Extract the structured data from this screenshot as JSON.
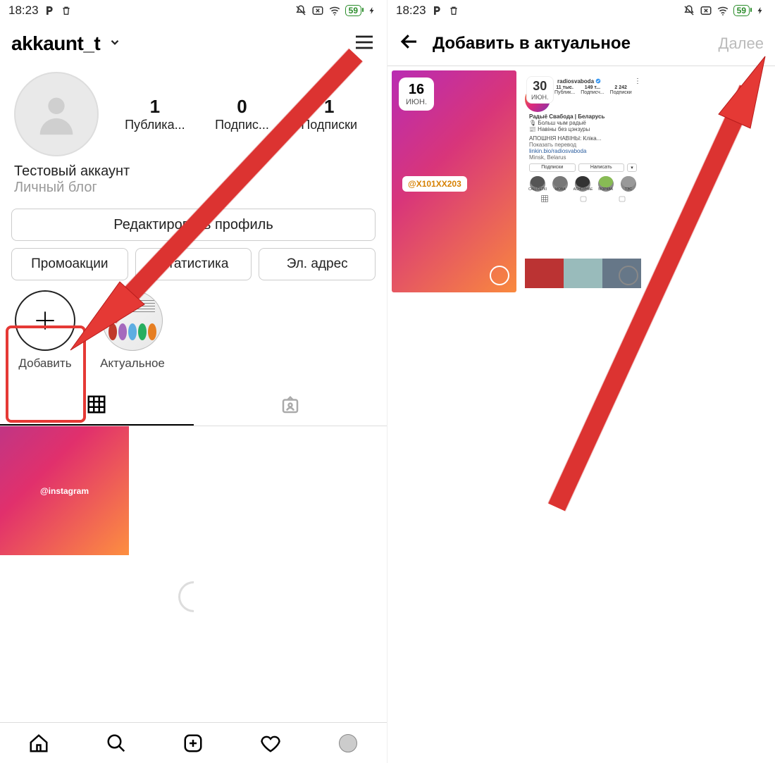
{
  "status": {
    "time": "18:23",
    "battery": "59"
  },
  "left": {
    "username": "akkaunt_t",
    "stats": {
      "posts": {
        "n": "1",
        "l": "Публика..."
      },
      "followers": {
        "n": "0",
        "l": "Подпис..."
      },
      "following": {
        "n": "1",
        "l": "Подписки"
      }
    },
    "bio_name": "Тестовый аккаунт",
    "bio_cat": "Личный блог",
    "btn_edit": "Редактировать профиль",
    "btn_promo": "Промоакции",
    "btn_stats": "Статистика",
    "btn_email": "Эл. адрес",
    "hl_add": "Добавить",
    "hl_actual": "Актуальное",
    "post_tag": "@instagram"
  },
  "right": {
    "title": "Добавить в актуальное",
    "next": "Далее",
    "story1": {
      "day": "16",
      "month": "ИЮН.",
      "mention": "@X101XX203"
    },
    "story2": {
      "day": "30",
      "month": "ИЮН.",
      "handle": "radiosvaboda",
      "s1": "11 тыс.",
      "s2": "149 т...",
      "s3": "2 242",
      "sl1": "Публик...",
      "sl2": "Подписч...",
      "sl3": "Подписки",
      "name": "Радыё Свабода | Беларусь",
      "desc1": "🎙 Больш чым радыё",
      "desc2": "📰 Навіны без цэнзуры",
      "news": "АПОШНІЯ НАВІНЫ: Кліка...",
      "translate": "Показать перевод",
      "link": "linkin.bio/radiosvaboda",
      "city": "Minsk, Belarus",
      "b1": "Подписки",
      "b2": "Написать",
      "h1": "САЦ.СЕТКІ",
      "h2": "МОВА",
      "h3": "АСНОЎНАЕ",
      "h4": "МОРКВА",
      "h5": "ТЭС"
    }
  }
}
